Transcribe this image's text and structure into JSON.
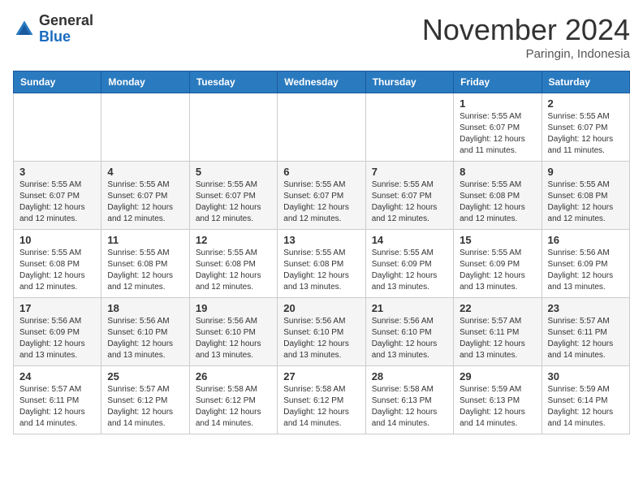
{
  "header": {
    "logo_general": "General",
    "logo_blue": "Blue",
    "month_title": "November 2024",
    "location": "Paringin, Indonesia"
  },
  "weekdays": [
    "Sunday",
    "Monday",
    "Tuesday",
    "Wednesday",
    "Thursday",
    "Friday",
    "Saturday"
  ],
  "weeks": [
    [
      {
        "day": "",
        "info": ""
      },
      {
        "day": "",
        "info": ""
      },
      {
        "day": "",
        "info": ""
      },
      {
        "day": "",
        "info": ""
      },
      {
        "day": "",
        "info": ""
      },
      {
        "day": "1",
        "info": "Sunrise: 5:55 AM\nSunset: 6:07 PM\nDaylight: 12 hours\nand 11 minutes."
      },
      {
        "day": "2",
        "info": "Sunrise: 5:55 AM\nSunset: 6:07 PM\nDaylight: 12 hours\nand 11 minutes."
      }
    ],
    [
      {
        "day": "3",
        "info": "Sunrise: 5:55 AM\nSunset: 6:07 PM\nDaylight: 12 hours\nand 12 minutes."
      },
      {
        "day": "4",
        "info": "Sunrise: 5:55 AM\nSunset: 6:07 PM\nDaylight: 12 hours\nand 12 minutes."
      },
      {
        "day": "5",
        "info": "Sunrise: 5:55 AM\nSunset: 6:07 PM\nDaylight: 12 hours\nand 12 minutes."
      },
      {
        "day": "6",
        "info": "Sunrise: 5:55 AM\nSunset: 6:07 PM\nDaylight: 12 hours\nand 12 minutes."
      },
      {
        "day": "7",
        "info": "Sunrise: 5:55 AM\nSunset: 6:07 PM\nDaylight: 12 hours\nand 12 minutes."
      },
      {
        "day": "8",
        "info": "Sunrise: 5:55 AM\nSunset: 6:08 PM\nDaylight: 12 hours\nand 12 minutes."
      },
      {
        "day": "9",
        "info": "Sunrise: 5:55 AM\nSunset: 6:08 PM\nDaylight: 12 hours\nand 12 minutes."
      }
    ],
    [
      {
        "day": "10",
        "info": "Sunrise: 5:55 AM\nSunset: 6:08 PM\nDaylight: 12 hours\nand 12 minutes."
      },
      {
        "day": "11",
        "info": "Sunrise: 5:55 AM\nSunset: 6:08 PM\nDaylight: 12 hours\nand 12 minutes."
      },
      {
        "day": "12",
        "info": "Sunrise: 5:55 AM\nSunset: 6:08 PM\nDaylight: 12 hours\nand 12 minutes."
      },
      {
        "day": "13",
        "info": "Sunrise: 5:55 AM\nSunset: 6:08 PM\nDaylight: 12 hours\nand 13 minutes."
      },
      {
        "day": "14",
        "info": "Sunrise: 5:55 AM\nSunset: 6:09 PM\nDaylight: 12 hours\nand 13 minutes."
      },
      {
        "day": "15",
        "info": "Sunrise: 5:55 AM\nSunset: 6:09 PM\nDaylight: 12 hours\nand 13 minutes."
      },
      {
        "day": "16",
        "info": "Sunrise: 5:56 AM\nSunset: 6:09 PM\nDaylight: 12 hours\nand 13 minutes."
      }
    ],
    [
      {
        "day": "17",
        "info": "Sunrise: 5:56 AM\nSunset: 6:09 PM\nDaylight: 12 hours\nand 13 minutes."
      },
      {
        "day": "18",
        "info": "Sunrise: 5:56 AM\nSunset: 6:10 PM\nDaylight: 12 hours\nand 13 minutes."
      },
      {
        "day": "19",
        "info": "Sunrise: 5:56 AM\nSunset: 6:10 PM\nDaylight: 12 hours\nand 13 minutes."
      },
      {
        "day": "20",
        "info": "Sunrise: 5:56 AM\nSunset: 6:10 PM\nDaylight: 12 hours\nand 13 minutes."
      },
      {
        "day": "21",
        "info": "Sunrise: 5:56 AM\nSunset: 6:10 PM\nDaylight: 12 hours\nand 13 minutes."
      },
      {
        "day": "22",
        "info": "Sunrise: 5:57 AM\nSunset: 6:11 PM\nDaylight: 12 hours\nand 13 minutes."
      },
      {
        "day": "23",
        "info": "Sunrise: 5:57 AM\nSunset: 6:11 PM\nDaylight: 12 hours\nand 14 minutes."
      }
    ],
    [
      {
        "day": "24",
        "info": "Sunrise: 5:57 AM\nSunset: 6:11 PM\nDaylight: 12 hours\nand 14 minutes."
      },
      {
        "day": "25",
        "info": "Sunrise: 5:57 AM\nSunset: 6:12 PM\nDaylight: 12 hours\nand 14 minutes."
      },
      {
        "day": "26",
        "info": "Sunrise: 5:58 AM\nSunset: 6:12 PM\nDaylight: 12 hours\nand 14 minutes."
      },
      {
        "day": "27",
        "info": "Sunrise: 5:58 AM\nSunset: 6:12 PM\nDaylight: 12 hours\nand 14 minutes."
      },
      {
        "day": "28",
        "info": "Sunrise: 5:58 AM\nSunset: 6:13 PM\nDaylight: 12 hours\nand 14 minutes."
      },
      {
        "day": "29",
        "info": "Sunrise: 5:59 AM\nSunset: 6:13 PM\nDaylight: 12 hours\nand 14 minutes."
      },
      {
        "day": "30",
        "info": "Sunrise: 5:59 AM\nSunset: 6:14 PM\nDaylight: 12 hours\nand 14 minutes."
      }
    ]
  ]
}
